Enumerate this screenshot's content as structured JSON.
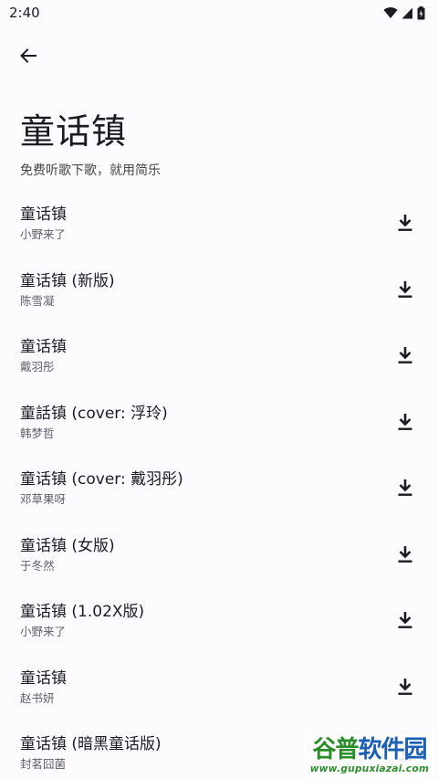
{
  "status": {
    "time": "2:40"
  },
  "header": {
    "title": "童话镇",
    "subtitle": "免费听歌下歌，就用简乐"
  },
  "songs": [
    {
      "title": "童话镇",
      "artist": "小野来了"
    },
    {
      "title": "童话镇 (新版)",
      "artist": "陈雪凝"
    },
    {
      "title": "童话镇",
      "artist": "戴羽彤"
    },
    {
      "title": "童話镇 (cover: 浮玲)",
      "artist": "韩梦哲"
    },
    {
      "title": "童话镇 (cover: 戴羽彤)",
      "artist": "邓草果呀"
    },
    {
      "title": "童话镇 (女版)",
      "artist": "于冬然"
    },
    {
      "title": "童话镇 (1.02X版)",
      "artist": "小野来了"
    },
    {
      "title": "童话镇",
      "artist": "赵书妍"
    },
    {
      "title": "童话镇 (暗黑童话版)",
      "artist": "封茗囧菌"
    }
  ],
  "watermark": {
    "name_a": "谷普",
    "name_b": "软件园",
    "url": "www.gupuxiazai.com"
  }
}
